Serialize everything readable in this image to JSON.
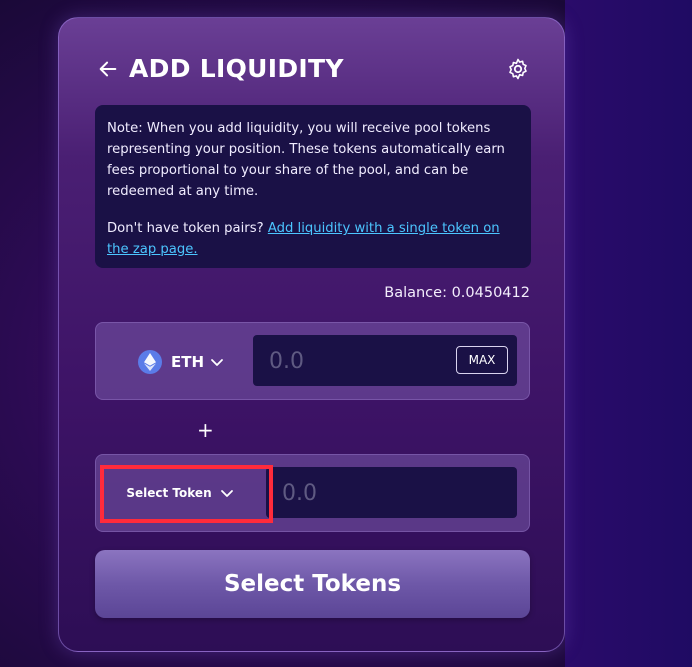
{
  "header": {
    "title": "ADD LIQUIDITY",
    "back_icon": "arrow-left-icon",
    "settings_icon": "gear-icon"
  },
  "note": {
    "text": "Note: When you add liquidity, you will receive pool tokens representing your position. These tokens automatically earn fees proportional to your share of the pool, and can be redeemed at any time.",
    "prompt": "Don't have token pairs?",
    "link": "Add liquidity with a single token on the zap page."
  },
  "balance": "Balance: 0.0450412",
  "token_a": {
    "symbol": "ETH",
    "icon": "ethereum-icon",
    "placeholder": "0.0",
    "max_label": "MAX"
  },
  "plus_sign": "+",
  "token_b": {
    "select_label": "Select Token",
    "placeholder": "0.0"
  },
  "submit_label": "Select Tokens",
  "colors": {
    "link": "#4cc5ff",
    "highlight": "#ff2b3b",
    "input_bg": "#1a1146"
  }
}
